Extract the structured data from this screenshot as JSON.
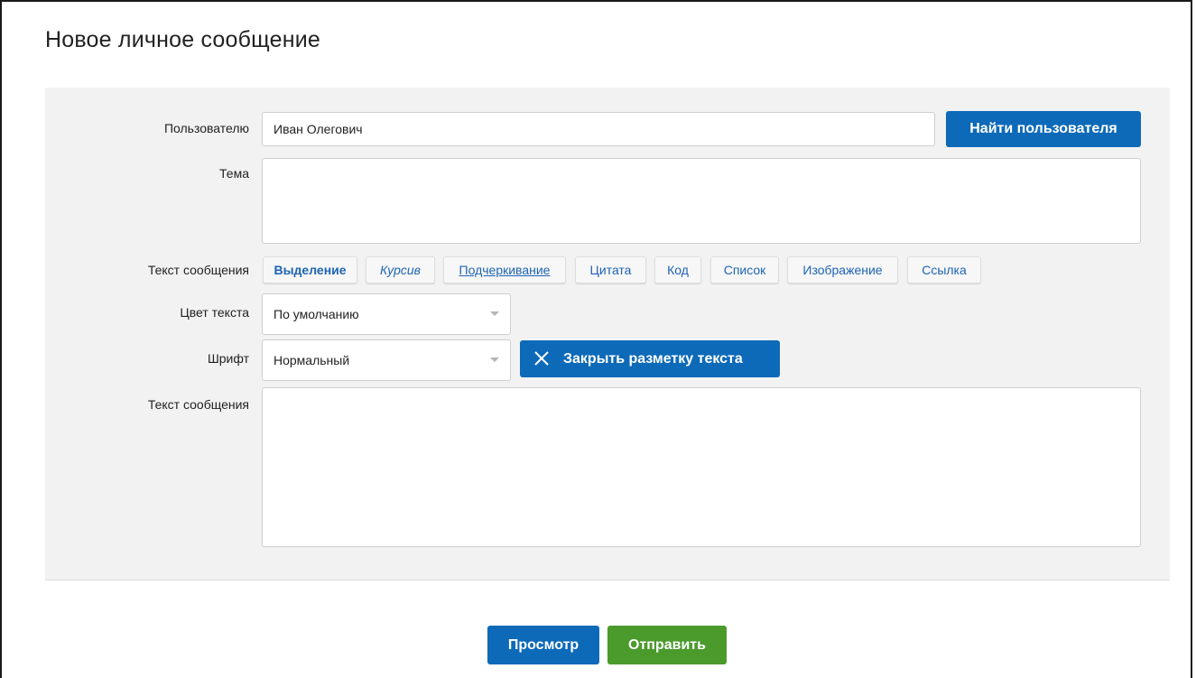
{
  "page": {
    "title": "Новое личное сообщение"
  },
  "form": {
    "recipient_label": "Пользователю",
    "recipient_value": "Иван Олегович",
    "find_user_button": "Найти пользователя",
    "subject_label": "Тема",
    "subject_value": "",
    "toolbar_label": "Текст сообщения",
    "toolbar": [
      {
        "label": "Выделение",
        "style": "bold"
      },
      {
        "label": "Курсив",
        "style": "italic"
      },
      {
        "label": "Подчеркивание",
        "style": "underline"
      },
      {
        "label": "Цитата",
        "style": "normal"
      },
      {
        "label": "Код",
        "style": "normal"
      },
      {
        "label": "Список",
        "style": "normal"
      },
      {
        "label": "Изображение",
        "style": "normal"
      },
      {
        "label": "Ссылка",
        "style": "normal"
      }
    ],
    "color_label": "Цвет текста",
    "color_value": "По умолчанию",
    "font_label": "Шрифт",
    "font_value": "Нормальный",
    "close_markup_button": "Закрыть разметку текста",
    "message_label": "Текст сообщения",
    "message_value": ""
  },
  "actions": {
    "preview_button": "Просмотр",
    "send_button": "Отправить"
  },
  "colors": {
    "primary": "#0d6ab8",
    "success": "#4a9a2c",
    "toolbar_text": "#1e64b4",
    "panel_bg": "#f2f2f2"
  },
  "icons": {
    "close": "close-icon",
    "dropdown": "chevron-down-icon"
  }
}
